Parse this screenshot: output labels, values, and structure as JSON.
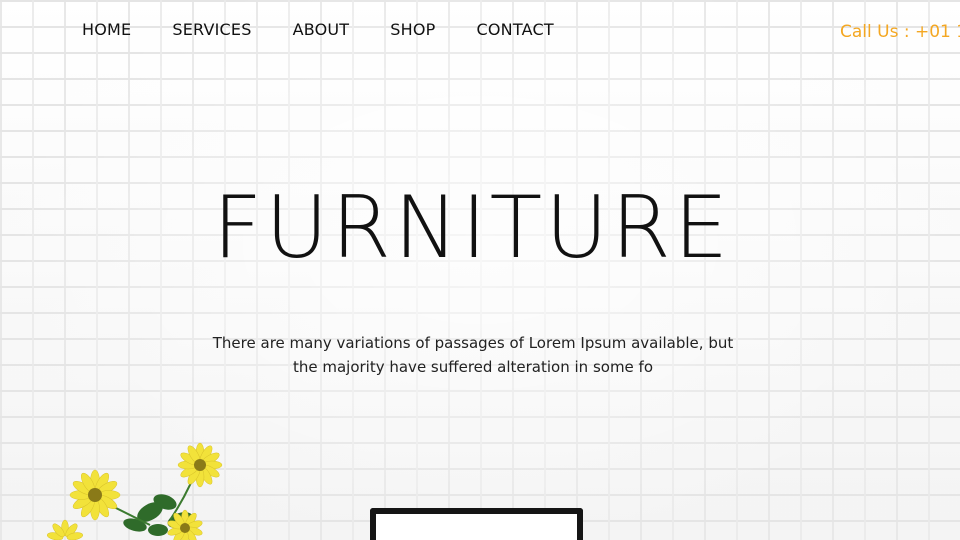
{
  "nav": {
    "items": [
      "HOME",
      "SERVICES",
      "ABOUT",
      "SHOP",
      "CONTACT"
    ]
  },
  "header": {
    "call_text": "Call Us : +01 1"
  },
  "hero": {
    "title": "FURNITURE",
    "text_line1": "There are many variations of passages of Lorem Ipsum available, but",
    "text_line2": "the majority have suffered alteration in some fo"
  },
  "colors": {
    "accent": "#f4a722",
    "text": "#111111",
    "background": "#f4f4f4"
  },
  "icons": {
    "flowers": "yellow-flowers-plant-image",
    "frame": "picture-frame-image"
  }
}
